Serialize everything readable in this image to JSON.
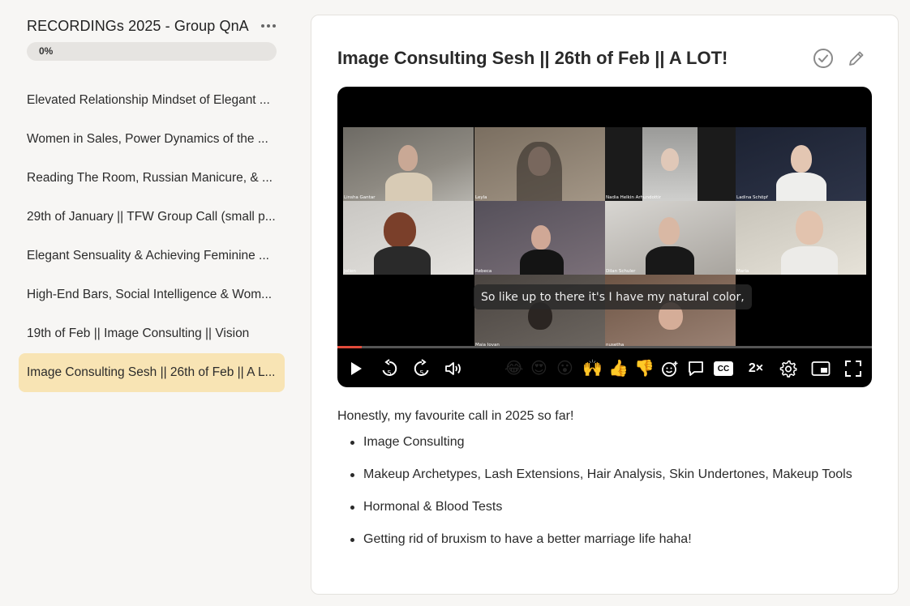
{
  "sidebar": {
    "course_title": "RECORDINGs 2025 - Group QnA",
    "progress_label": "0%",
    "progress_value": 0,
    "lessons": [
      {
        "label": "Elevated Relationship Mindset of Elegant ...",
        "active": false
      },
      {
        "label": "Women in Sales, Power Dynamics of the ...",
        "active": false
      },
      {
        "label": "Reading The Room, Russian Manicure, & ...",
        "active": false
      },
      {
        "label": "29th of January || TFW Group Call (small p...",
        "active": false
      },
      {
        "label": "Elegant Sensuality & Achieving Feminine ...",
        "active": false
      },
      {
        "label": "High-End Bars, Social Intelligence & Wom...",
        "active": false
      },
      {
        "label": "19th of Feb || Image Consulting || Vision",
        "active": false
      },
      {
        "label": "Image Consulting Sesh || 26th of Feb || A L...",
        "active": true
      }
    ]
  },
  "main": {
    "title": "Image Consulting Sesh || 26th of Feb || A LOT!",
    "video": {
      "participants": [
        "Linsha Gantar",
        "Leyla",
        "Nadia Helkin Arhundottir",
        "Ladina Schöpf",
        "Jolien",
        "Rebeca",
        "Dilan Schuler",
        "Maria",
        "Maja Jovan",
        "nusetha"
      ],
      "caption": "So like up to there it's I have my natural color,",
      "progress_fraction": 0.045,
      "speed_label": "2×",
      "cc_label": "CC",
      "skip_back_label": "5",
      "skip_fwd_label": "5",
      "reactions": [
        "😂",
        "😍",
        "😮",
        "🙌",
        "👍",
        "👎"
      ]
    },
    "description": {
      "intro": "Honestly, my favourite call in 2025 so far!",
      "bullets": [
        "Image Consulting",
        "Makeup Archetypes, Lash Extensions, Hair Analysis, Skin Undertones, Makeup Tools",
        "Hormonal & Blood Tests",
        "Getting rid of bruxism to have a better marriage life haha!"
      ]
    }
  },
  "colors": {
    "active_lesson_bg": "#f8e4b4",
    "progress_track": "#e6e4e1",
    "scrub_fill": "#e24b3b",
    "page_bg": "#f7f6f4"
  }
}
